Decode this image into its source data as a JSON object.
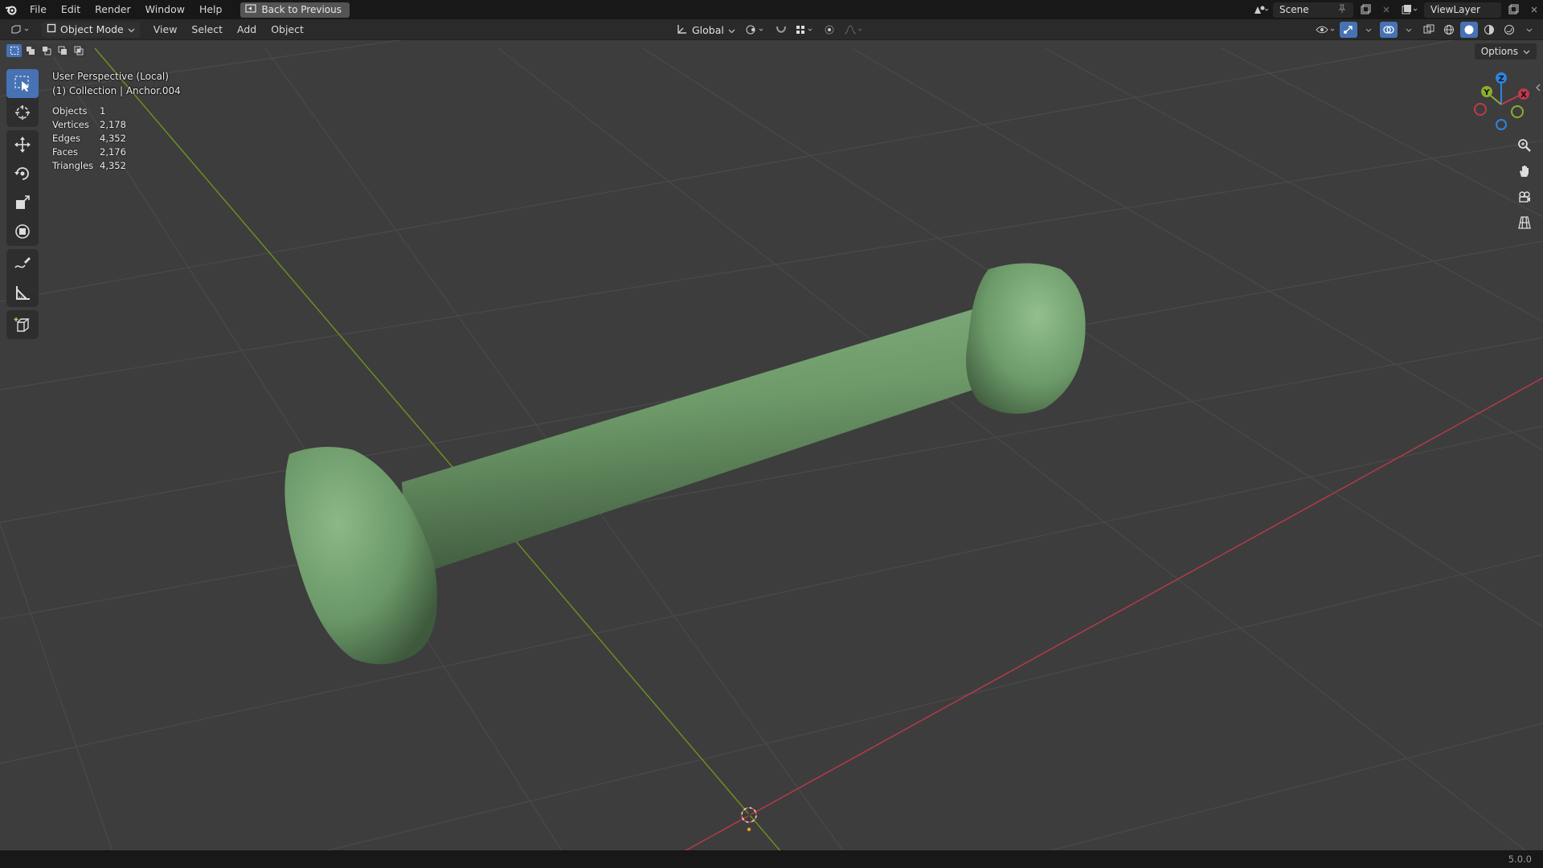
{
  "topbar": {
    "menus": [
      "File",
      "Edit",
      "Render",
      "Window",
      "Help"
    ],
    "back_button": "Back to Previous",
    "scene_name": "Scene",
    "view_layer": "ViewLayer"
  },
  "header": {
    "mode": "Object Mode",
    "menus": [
      "View",
      "Select",
      "Add",
      "Object"
    ],
    "transform_orientation": "Global",
    "options_label": "Options"
  },
  "viewport": {
    "perspective_label": "User Perspective (Local)",
    "collection_label": "(1) Collection | Anchor.004",
    "stats": [
      {
        "label": "Objects",
        "value": "1"
      },
      {
        "label": "Vertices",
        "value": "2,178"
      },
      {
        "label": "Edges",
        "value": "4,352"
      },
      {
        "label": "Faces",
        "value": "2,176"
      },
      {
        "label": "Triangles",
        "value": "4,352"
      }
    ],
    "gizmo_axes": [
      "X",
      "Y",
      "Z"
    ],
    "object_color": "#6f9b6b"
  },
  "statusbar": {
    "version": "5.0.0"
  },
  "colors": {
    "accent": "#4772b3",
    "x_axis": "#c0394b",
    "y_axis": "#8bae2d",
    "z_axis": "#2f83e0"
  }
}
